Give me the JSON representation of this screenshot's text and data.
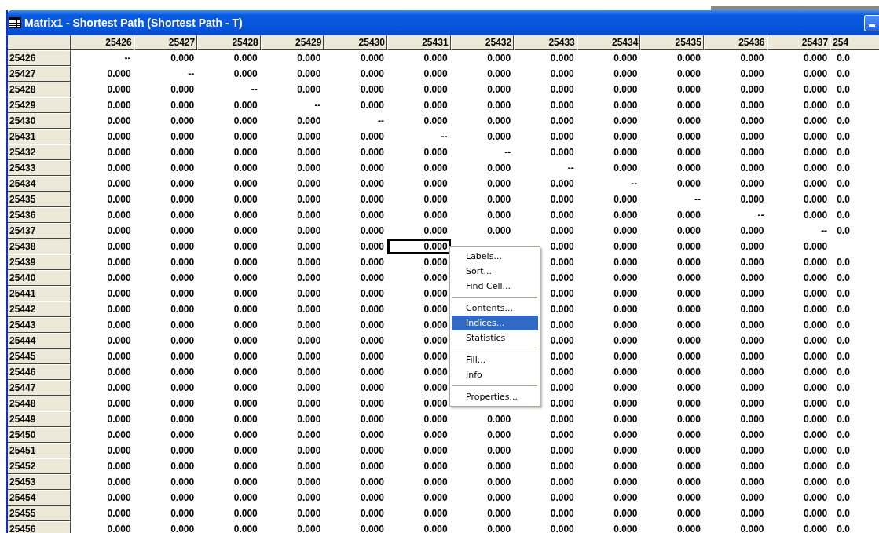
{
  "window": {
    "title": "Matrix1 - Shortest Path (Shortest Path - T)"
  },
  "table": {
    "columns": [
      {
        "label": "25426",
        "selected": false
      },
      {
        "label": "25427",
        "selected": false
      },
      {
        "label": "25428",
        "selected": false
      },
      {
        "label": "25429",
        "selected": false
      },
      {
        "label": "25430",
        "selected": false
      },
      {
        "label": "25431",
        "selected": true
      },
      {
        "label": "25432",
        "selected": false
      },
      {
        "label": "25433",
        "selected": false
      },
      {
        "label": "25434",
        "selected": false
      },
      {
        "label": "25435",
        "selected": false
      },
      {
        "label": "25436",
        "selected": false
      },
      {
        "label": "25437",
        "selected": false
      },
      {
        "label": "254",
        "selected": false
      }
    ],
    "rows": [
      {
        "label": "25426",
        "selected": false,
        "cells": [
          "--",
          "0.000",
          "0.000",
          "0.000",
          "0.000",
          "0.000",
          "0.000",
          "0.000",
          "0.000",
          "0.000",
          "0.000",
          "0.000",
          "0.0"
        ]
      },
      {
        "label": "25427",
        "selected": false,
        "cells": [
          "0.000",
          "--",
          "0.000",
          "0.000",
          "0.000",
          "0.000",
          "0.000",
          "0.000",
          "0.000",
          "0.000",
          "0.000",
          "0.000",
          "0.0"
        ]
      },
      {
        "label": "25428",
        "selected": false,
        "cells": [
          "0.000",
          "0.000",
          "--",
          "0.000",
          "0.000",
          "0.000",
          "0.000",
          "0.000",
          "0.000",
          "0.000",
          "0.000",
          "0.000",
          "0.0"
        ]
      },
      {
        "label": "25429",
        "selected": false,
        "cells": [
          "0.000",
          "0.000",
          "0.000",
          "--",
          "0.000",
          "0.000",
          "0.000",
          "0.000",
          "0.000",
          "0.000",
          "0.000",
          "0.000",
          "0.0"
        ]
      },
      {
        "label": "25430",
        "selected": false,
        "cells": [
          "0.000",
          "0.000",
          "0.000",
          "0.000",
          "--",
          "0.000",
          "0.000",
          "0.000",
          "0.000",
          "0.000",
          "0.000",
          "0.000",
          "0.0"
        ]
      },
      {
        "label": "25431",
        "selected": false,
        "cells": [
          "0.000",
          "0.000",
          "0.000",
          "0.000",
          "0.000",
          "--",
          "0.000",
          "0.000",
          "0.000",
          "0.000",
          "0.000",
          "0.000",
          "0.0"
        ]
      },
      {
        "label": "25432",
        "selected": false,
        "cells": [
          "0.000",
          "0.000",
          "0.000",
          "0.000",
          "0.000",
          "0.000",
          "--",
          "0.000",
          "0.000",
          "0.000",
          "0.000",
          "0.000",
          "0.0"
        ]
      },
      {
        "label": "25433",
        "selected": false,
        "cells": [
          "0.000",
          "0.000",
          "0.000",
          "0.000",
          "0.000",
          "0.000",
          "0.000",
          "--",
          "0.000",
          "0.000",
          "0.000",
          "0.000",
          "0.0"
        ]
      },
      {
        "label": "25434",
        "selected": false,
        "cells": [
          "0.000",
          "0.000",
          "0.000",
          "0.000",
          "0.000",
          "0.000",
          "0.000",
          "0.000",
          "--",
          "0.000",
          "0.000",
          "0.000",
          "0.0"
        ]
      },
      {
        "label": "25435",
        "selected": false,
        "cells": [
          "0.000",
          "0.000",
          "0.000",
          "0.000",
          "0.000",
          "0.000",
          "0.000",
          "0.000",
          "0.000",
          "--",
          "0.000",
          "0.000",
          "0.0"
        ]
      },
      {
        "label": "25436",
        "selected": false,
        "cells": [
          "0.000",
          "0.000",
          "0.000",
          "0.000",
          "0.000",
          "0.000",
          "0.000",
          "0.000",
          "0.000",
          "0.000",
          "--",
          "0.000",
          "0.0"
        ]
      },
      {
        "label": "25437",
        "selected": false,
        "cells": [
          "0.000",
          "0.000",
          "0.000",
          "0.000",
          "0.000",
          "0.000",
          "0.000",
          "0.000",
          "0.000",
          "0.000",
          "0.000",
          "--",
          "0.0"
        ]
      },
      {
        "label": "25438",
        "selected": true,
        "cells": [
          "0.000",
          "0.000",
          "0.000",
          "0.000",
          "0.000",
          "0.000",
          null,
          "0.000",
          "0.000",
          "0.000",
          "0.000",
          "0.000",
          null
        ]
      },
      {
        "label": "25439",
        "selected": false,
        "cells": [
          "0.000",
          "0.000",
          "0.000",
          "0.000",
          "0.000",
          "0.000",
          null,
          "0.000",
          "0.000",
          "0.000",
          "0.000",
          "0.000",
          "0.0"
        ]
      },
      {
        "label": "25440",
        "selected": false,
        "cells": [
          "0.000",
          "0.000",
          "0.000",
          "0.000",
          "0.000",
          "0.000",
          null,
          "0.000",
          "0.000",
          "0.000",
          "0.000",
          "0.000",
          "0.0"
        ]
      },
      {
        "label": "25441",
        "selected": false,
        "cells": [
          "0.000",
          "0.000",
          "0.000",
          "0.000",
          "0.000",
          "0.000",
          null,
          "0.000",
          "0.000",
          "0.000",
          "0.000",
          "0.000",
          "0.0"
        ]
      },
      {
        "label": "25442",
        "selected": false,
        "cells": [
          "0.000",
          "0.000",
          "0.000",
          "0.000",
          "0.000",
          "0.000",
          null,
          "0.000",
          "0.000",
          "0.000",
          "0.000",
          "0.000",
          "0.0"
        ]
      },
      {
        "label": "25443",
        "selected": false,
        "cells": [
          "0.000",
          "0.000",
          "0.000",
          "0.000",
          "0.000",
          "0.000",
          null,
          "0.000",
          "0.000",
          "0.000",
          "0.000",
          "0.000",
          "0.0"
        ]
      },
      {
        "label": "25444",
        "selected": false,
        "cells": [
          "0.000",
          "0.000",
          "0.000",
          "0.000",
          "0.000",
          "0.000",
          null,
          "0.000",
          "0.000",
          "0.000",
          "0.000",
          "0.000",
          "0.0"
        ]
      },
      {
        "label": "25445",
        "selected": false,
        "cells": [
          "0.000",
          "0.000",
          "0.000",
          "0.000",
          "0.000",
          "0.000",
          null,
          "0.000",
          "0.000",
          "0.000",
          "0.000",
          "0.000",
          "0.0"
        ]
      },
      {
        "label": "25446",
        "selected": false,
        "cells": [
          "0.000",
          "0.000",
          "0.000",
          "0.000",
          "0.000",
          "0.000",
          null,
          "0.000",
          "0.000",
          "0.000",
          "0.000",
          "0.000",
          "0.0"
        ]
      },
      {
        "label": "25447",
        "selected": false,
        "cells": [
          "0.000",
          "0.000",
          "0.000",
          "0.000",
          "0.000",
          "0.000",
          null,
          "0.000",
          "0.000",
          "0.000",
          "0.000",
          "0.000",
          "0.0"
        ]
      },
      {
        "label": "25448",
        "selected": false,
        "cells": [
          "0.000",
          "0.000",
          "0.000",
          "0.000",
          "0.000",
          "0.000",
          null,
          "0.000",
          "0.000",
          "0.000",
          "0.000",
          "0.000",
          "0.0"
        ]
      },
      {
        "label": "25449",
        "selected": false,
        "cells": [
          "0.000",
          "0.000",
          "0.000",
          "0.000",
          "0.000",
          "0.000",
          "0.000",
          "0.000",
          "0.000",
          "0.000",
          "0.000",
          "0.000",
          "0.0"
        ]
      },
      {
        "label": "25450",
        "selected": false,
        "cells": [
          "0.000",
          "0.000",
          "0.000",
          "0.000",
          "0.000",
          "0.000",
          "0.000",
          "0.000",
          "0.000",
          "0.000",
          "0.000",
          "0.000",
          "0.0"
        ]
      },
      {
        "label": "25451",
        "selected": false,
        "cells": [
          "0.000",
          "0.000",
          "0.000",
          "0.000",
          "0.000",
          "0.000",
          "0.000",
          "0.000",
          "0.000",
          "0.000",
          "0.000",
          "0.000",
          "0.0"
        ]
      },
      {
        "label": "25452",
        "selected": false,
        "cells": [
          "0.000",
          "0.000",
          "0.000",
          "0.000",
          "0.000",
          "0.000",
          "0.000",
          "0.000",
          "0.000",
          "0.000",
          "0.000",
          "0.000",
          "0.0"
        ]
      },
      {
        "label": "25453",
        "selected": false,
        "cells": [
          "0.000",
          "0.000",
          "0.000",
          "0.000",
          "0.000",
          "0.000",
          "0.000",
          "0.000",
          "0.000",
          "0.000",
          "0.000",
          "0.000",
          "0.0"
        ]
      },
      {
        "label": "25454",
        "selected": false,
        "cells": [
          "0.000",
          "0.000",
          "0.000",
          "0.000",
          "0.000",
          "0.000",
          "0.000",
          "0.000",
          "0.000",
          "0.000",
          "0.000",
          "0.000",
          "0.0"
        ]
      },
      {
        "label": "25455",
        "selected": false,
        "cells": [
          "0.000",
          "0.000",
          "0.000",
          "0.000",
          "0.000",
          "0.000",
          "0.000",
          "0.000",
          "0.000",
          "0.000",
          "0.000",
          "0.000",
          "0.0"
        ]
      },
      {
        "label": "25456",
        "selected": false,
        "cells": [
          "0.000",
          "0.000",
          "0.000",
          "0.000",
          "0.000",
          "0.000",
          "0.000",
          "0.000",
          "0.000",
          "0.000",
          "0.000",
          "0.000",
          "0.0"
        ]
      }
    ]
  },
  "context_menu": {
    "items": [
      {
        "kind": "item",
        "label": "Labels...",
        "selected": false
      },
      {
        "kind": "item",
        "label": "Sort...",
        "selected": false
      },
      {
        "kind": "item",
        "label": "Find Cell...",
        "selected": false
      },
      {
        "kind": "separator"
      },
      {
        "kind": "item",
        "label": "Contents...",
        "selected": false
      },
      {
        "kind": "item",
        "label": "Indices...",
        "selected": true
      },
      {
        "kind": "item",
        "label": "Statistics",
        "selected": false
      },
      {
        "kind": "separator"
      },
      {
        "kind": "item",
        "label": "Fill...",
        "selected": false
      },
      {
        "kind": "item",
        "label": "Info",
        "selected": false
      },
      {
        "kind": "separator"
      },
      {
        "kind": "item",
        "label": "Properties...",
        "selected": false
      }
    ]
  }
}
